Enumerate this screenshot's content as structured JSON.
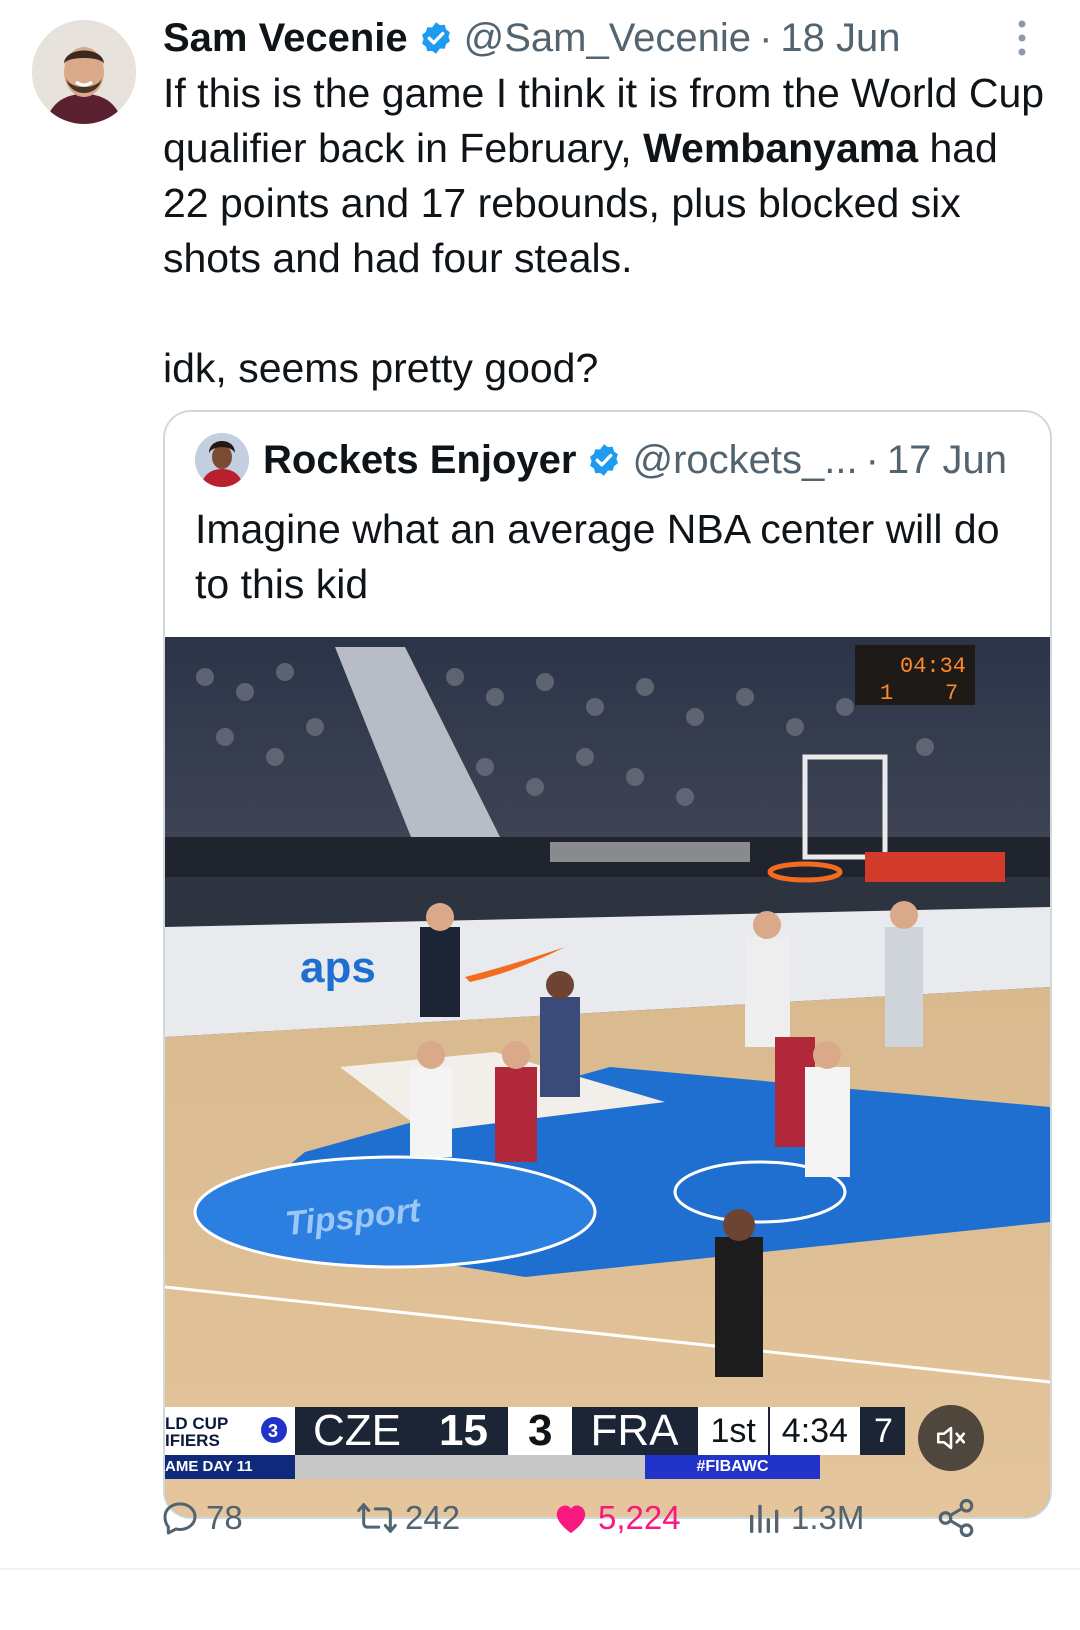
{
  "tweet": {
    "author_name": "Sam Vecenie",
    "handle": "@Sam_Vecenie",
    "separator": "·",
    "date": "18 Jun",
    "text_part1": "If this is the game I think it is from the World Cup qualifier back in February, ",
    "text_bold": "Wembanyama",
    "text_part2": " had 22 points and 17 rebounds, plus blocked six shots and had four steals.",
    "text_line2": "idk, seems pretty good?"
  },
  "quoted": {
    "author_name": "Rockets Enjoyer",
    "handle": "@rockets_...",
    "separator": "·",
    "date": "17 Jun",
    "text": "Imagine what an average NBA center will do to this kid"
  },
  "video": {
    "scorebug_left_line1": "LD CUP",
    "scorebug_left_line2": "IFIERS",
    "scorebug_day": "AME DAY 11",
    "team1": "CZE",
    "score1": "15",
    "score2": "3",
    "team2": "FRA",
    "period": "1st",
    "clock": "4:34",
    "shot_clock": "7",
    "hashtag": "#FIBAWC",
    "arena_clock": "04:34",
    "arena_left": "1",
    "arena_right": "7",
    "floor_brand": "Tipsport",
    "ad_board": "aps",
    "mute_icon": "speaker-muted-icon"
  },
  "actions": {
    "replies": "78",
    "reposts": "242",
    "likes": "5,224",
    "views": "1.3M"
  },
  "colors": {
    "like": "#f91880",
    "verified": "#1d9bf0",
    "muted_text": "#536471",
    "court_blue": "#1f6fd1"
  }
}
